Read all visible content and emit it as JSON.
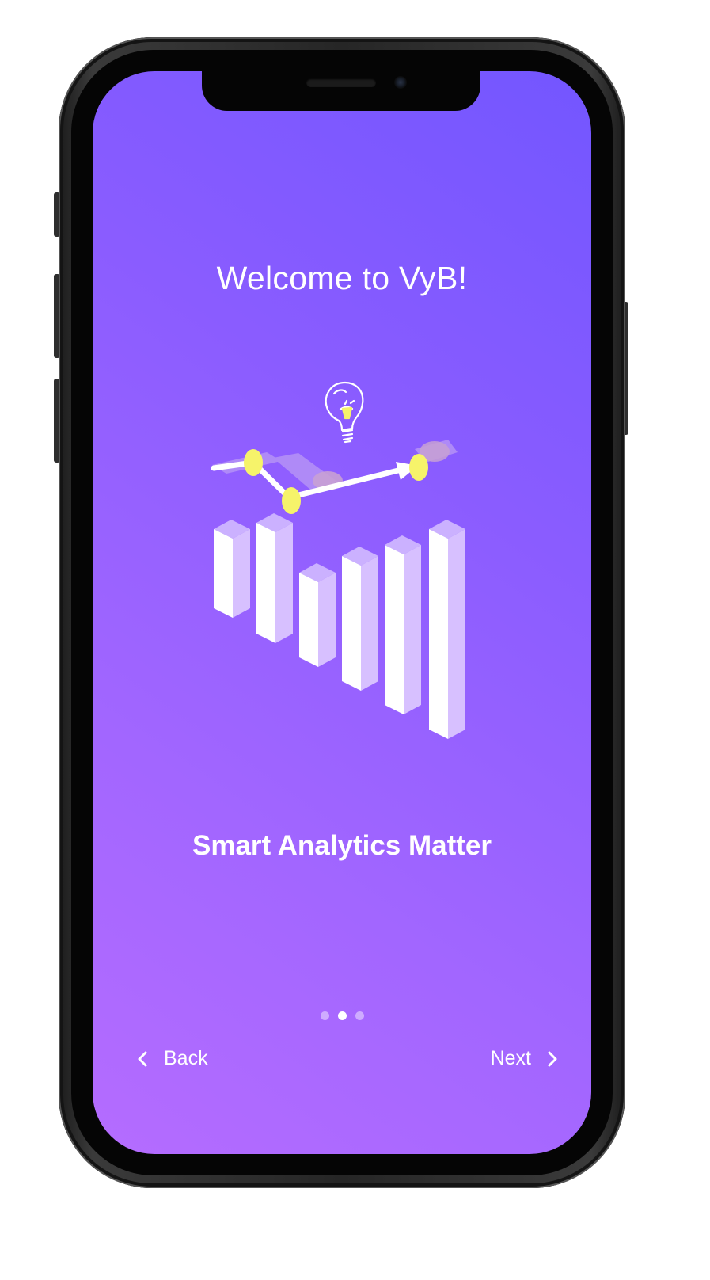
{
  "onboarding": {
    "welcome_title": "Welcome to VyB!",
    "slide_title": "Smart Analytics Matter",
    "page_indicator": {
      "total": 3,
      "current": 2
    },
    "back_label": "Back",
    "next_label": "Next"
  },
  "icons": {
    "illustration": "analytics-bar-chart-illustration",
    "bulb": "lightbulb-icon",
    "back": "chevron-left-icon",
    "next": "chevron-right-icon"
  },
  "colors": {
    "gradient_start": "#7356ff",
    "gradient_end": "#b56cff",
    "text": "#ffffff",
    "accent_yellow": "#f6f36a"
  }
}
